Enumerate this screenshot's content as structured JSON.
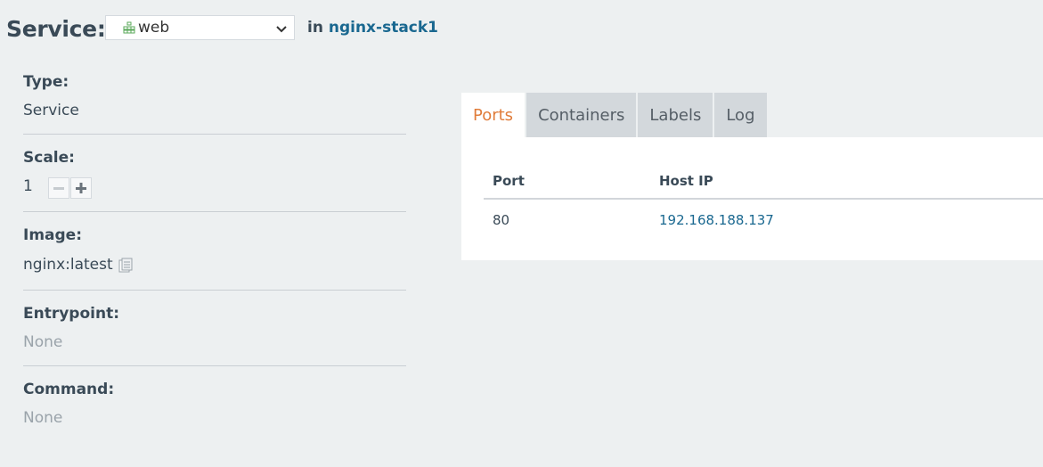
{
  "header": {
    "title": "Service:",
    "selected_service": "web",
    "service_icon": "service-icon",
    "in_label": "in",
    "stack_name": "nginx-stack1"
  },
  "details": {
    "type": {
      "label": "Type:",
      "value": "Service"
    },
    "scale": {
      "label": "Scale:",
      "value": "1"
    },
    "image": {
      "label": "Image:",
      "value": "nginx:latest"
    },
    "entrypoint": {
      "label": "Entrypoint:",
      "value": "None"
    },
    "command": {
      "label": "Command:",
      "value": "None"
    }
  },
  "tabs": [
    {
      "label": "Ports",
      "active": true
    },
    {
      "label": "Containers",
      "active": false
    },
    {
      "label": "Labels",
      "active": false
    },
    {
      "label": "Log",
      "active": false
    }
  ],
  "ports_table": {
    "columns": [
      "Port",
      "Host IP"
    ],
    "rows": [
      {
        "port": "80",
        "host_ip": "192.168.188.137"
      }
    ]
  },
  "colors": {
    "accent_orange": "#e07c3a",
    "link_blue": "#1a6890",
    "background": "#edf0f1",
    "service_icon_green": "#5aa85a"
  }
}
